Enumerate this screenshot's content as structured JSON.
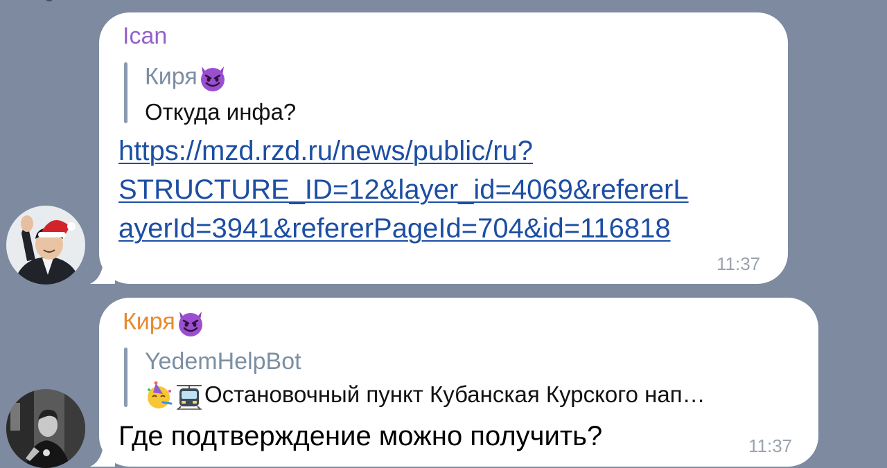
{
  "messages": [
    {
      "sender": "Ican",
      "sender_color": "#9463c9",
      "reply": {
        "name": "Киря",
        "name_emoji": "devil-face-icon",
        "text": "Откуда инфа?"
      },
      "link_lines": [
        "https://mzd.rzd.ru/news/public/ru?",
        "STRUCTURE_ID=12&layer_id=4069&refererL",
        "ayerId=3941&refererPageId=704&id=116818"
      ],
      "time": "11:37"
    },
    {
      "sender": "Киря",
      "sender_color": "#e68a2e",
      "sender_emoji": "devil-face-icon",
      "reply": {
        "name": "YedemHelpBot",
        "text_emojis": [
          "party-face-icon",
          "tram-icon"
        ],
        "text": "Остановочный пункт Кубанская Курского нап…"
      },
      "text": "Где подтверждение можно получить?",
      "time": "11:37"
    }
  ]
}
